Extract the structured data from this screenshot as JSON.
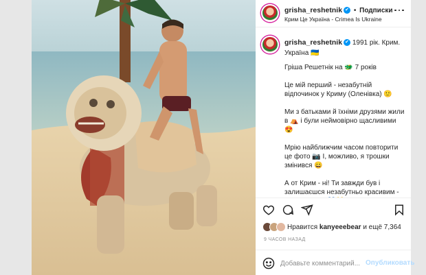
{
  "post": {
    "username": "grisha_reshetnik",
    "verified_mark": "✔",
    "dot": "•",
    "follow_label": "Подписки",
    "location": "Крим Це Україна - Crimea Is Ukraine",
    "caption_head": "1991 рік. Крим. Україна 🇺🇦",
    "paragraphs": [
      "Гріша Решетнік на 🐲 7 років",
      "Це мій перший - незабутній відпочинок у Криму (Оленівка) 🙂",
      "Ми з батьками й їхніми друзями жили в ⛺ і були неймовірно щасливими 😍",
      "Мрію найближчим часом повторити це фото 📷 І, можливо, я трошки змінився 😄",
      "А от Крим - ні! Ти завжди був і залишаєшся незабутньо красивим - Українським! 💙💛"
    ]
  },
  "actions": {
    "like_icon": "heart-icon",
    "comment_icon": "comment-icon",
    "share_icon": "share-icon",
    "save_icon": "bookmark-icon"
  },
  "likes": {
    "prefix": "Нравится",
    "user": "kanyeeebear",
    "suffix": "и ещё 7,364"
  },
  "time_ago": "9 ЧАСОВ НАЗАД",
  "comment": {
    "placeholder": "Добавьте комментарий...",
    "publish_label": "Опубликовать"
  },
  "colors": {
    "accent": "#0095f6",
    "publish_disabled": "#b3dbff",
    "secondary_text": "#8e8e8e"
  }
}
